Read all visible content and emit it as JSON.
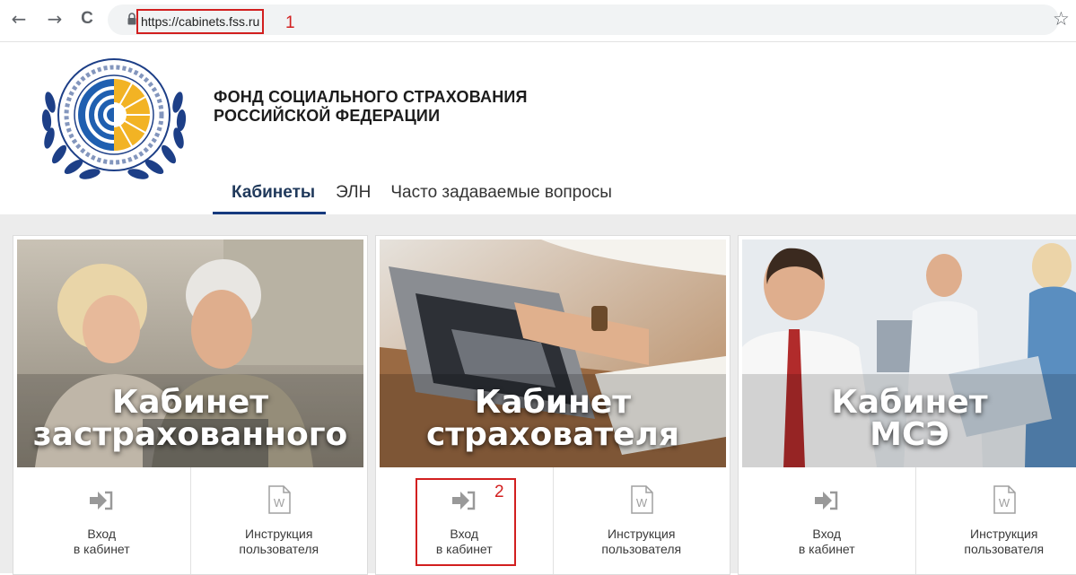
{
  "browser": {
    "back_icon": "←",
    "forward_icon": "→",
    "reload_icon": "C",
    "url": "https://cabinets.fss.ru",
    "star_icon": "☆",
    "marker_url": "1"
  },
  "site": {
    "org_name_line1": "ФОНД СОЦИАЛЬНОГО СТРАХОВАНИЯ",
    "org_name_line2": "РОССИЙСКОЙ ФЕДЕРАЦИИ",
    "tabs": [
      {
        "label": "Кабинеты",
        "active": true
      },
      {
        "label": "ЭЛН",
        "active": false
      },
      {
        "label": "Часто задаваемые вопросы",
        "active": false
      }
    ]
  },
  "cards": [
    {
      "title_line1": "Кабинет",
      "title_line2": "застрахованного",
      "login_line1": "Вход",
      "login_line2": "в кабинет",
      "manual_line1": "Инструкция",
      "manual_line2": "пользователя"
    },
    {
      "title_line1": "Кабинет",
      "title_line2": "страхователя",
      "login_line1": "Вход",
      "login_line2": "в кабинет",
      "manual_line1": "Инструкция",
      "manual_line2": "пользователя",
      "marker": "2"
    },
    {
      "title_line1": "Кабинет",
      "title_line2": "МСЭ",
      "login_line1": "Вход",
      "login_line2": "в кабинет",
      "manual_line1": "Инструкция",
      "manual_line2": "пользователя"
    }
  ],
  "colors": {
    "highlight": "#d21f1f",
    "nav_accent": "#163a7e",
    "logo_blue": "#1f5fb0",
    "logo_yellow": "#f2b324"
  }
}
